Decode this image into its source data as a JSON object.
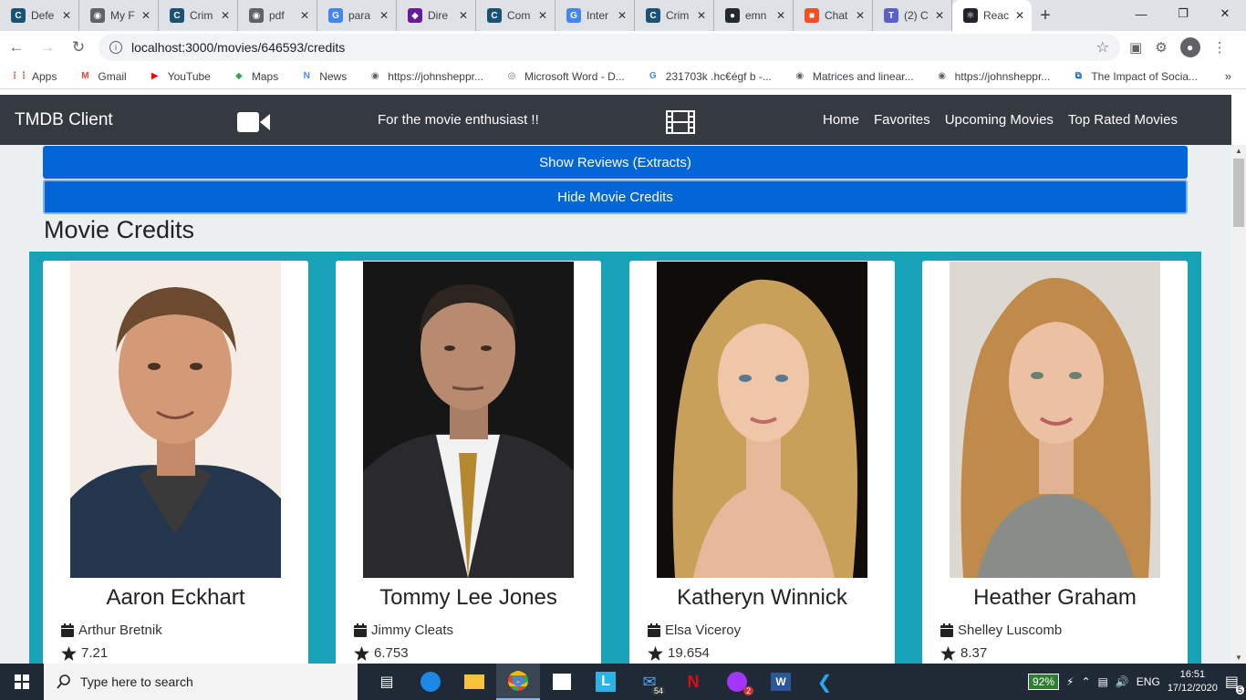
{
  "browser": {
    "tabs": [
      {
        "title": "Defe",
        "color": "#1a5276",
        "glyph": "C"
      },
      {
        "title": "My F",
        "color": "#5f6368",
        "glyph": "◉"
      },
      {
        "title": "Crim",
        "color": "#1a5276",
        "glyph": "C"
      },
      {
        "title": "pdf",
        "color": "#5f6368",
        "glyph": "◉"
      },
      {
        "title": "para",
        "color": "#4285f4",
        "glyph": "G"
      },
      {
        "title": "Dire",
        "color": "#6a1b9a",
        "glyph": "◆"
      },
      {
        "title": "Com",
        "color": "#1a5276",
        "glyph": "C"
      },
      {
        "title": "Inter",
        "color": "#4285f4",
        "glyph": "G"
      },
      {
        "title": "Crim",
        "color": "#1a5276",
        "glyph": "C"
      },
      {
        "title": "emn",
        "color": "#24292e",
        "glyph": "●"
      },
      {
        "title": "Chat",
        "color": "#f25022",
        "glyph": "■"
      },
      {
        "title": "(2) C",
        "color": "#5b5fc7",
        "glyph": "T"
      },
      {
        "title": "Reac",
        "color": "#20232a",
        "glyph": "⚛"
      }
    ],
    "url": "localhost:3000/movies/646593/credits"
  },
  "bookmarks": [
    {
      "label": "Apps",
      "icon": "apps-grid-icon",
      "color": "#ea4335",
      "glyph": "⋮⋮"
    },
    {
      "label": "Gmail",
      "icon": "gmail-icon",
      "color": "#ea4335",
      "glyph": "M"
    },
    {
      "label": "YouTube",
      "icon": "youtube-icon",
      "color": "#ff0000",
      "glyph": "▶"
    },
    {
      "label": "Maps",
      "icon": "maps-icon",
      "color": "#34a853",
      "glyph": "◆"
    },
    {
      "label": "News",
      "icon": "news-icon",
      "color": "#4285f4",
      "glyph": "N"
    },
    {
      "label": "https://johnsheppr...",
      "icon": "globe-icon",
      "color": "#5f6368",
      "glyph": "◉"
    },
    {
      "label": "Microsoft Word - D...",
      "icon": "word-doc-icon",
      "color": "#8d6e63",
      "glyph": "◎"
    },
    {
      "label": "231703k .hc€égf b -...",
      "icon": "google-icon",
      "color": "#4285f4",
      "glyph": "G"
    },
    {
      "label": "Matrices and linear...",
      "icon": "globe-icon",
      "color": "#5f6368",
      "glyph": "◉"
    },
    {
      "label": "https://johnsheppr...",
      "icon": "globe-icon",
      "color": "#5f6368",
      "glyph": "◉"
    },
    {
      "label": "The Impact of Socia...",
      "icon": "doc-icon",
      "color": "#1565c0",
      "glyph": "⧉"
    }
  ],
  "app": {
    "brand": "TMDB Client",
    "tagline": "For the movie enthusiast !!",
    "nav": [
      "Home",
      "Favorites",
      "Upcoming Movies",
      "Top Rated Movies"
    ],
    "show_reviews_label": "Show Reviews (Extracts)",
    "hide_credits_label": "Hide Movie Credits",
    "section_title": "Movie Credits"
  },
  "credits": [
    {
      "name": "Aaron Eckhart",
      "character": "Arthur Bretnik",
      "rating": "7.21"
    },
    {
      "name": "Tommy Lee Jones",
      "character": "Jimmy Cleats",
      "rating": "6.753"
    },
    {
      "name": "Katheryn Winnick",
      "character": "Elsa Viceroy",
      "rating": "19.654"
    },
    {
      "name": "Heather Graham",
      "character": "Shelley Luscomb",
      "rating": "8.37"
    }
  ],
  "taskbar": {
    "search_placeholder": "Type here to search",
    "battery": "92%",
    "language": "ENG",
    "time": "16:51",
    "date": "17/12/2020",
    "mail_badge": "54",
    "messenger_badge": "2",
    "notifications_badge": "5"
  }
}
